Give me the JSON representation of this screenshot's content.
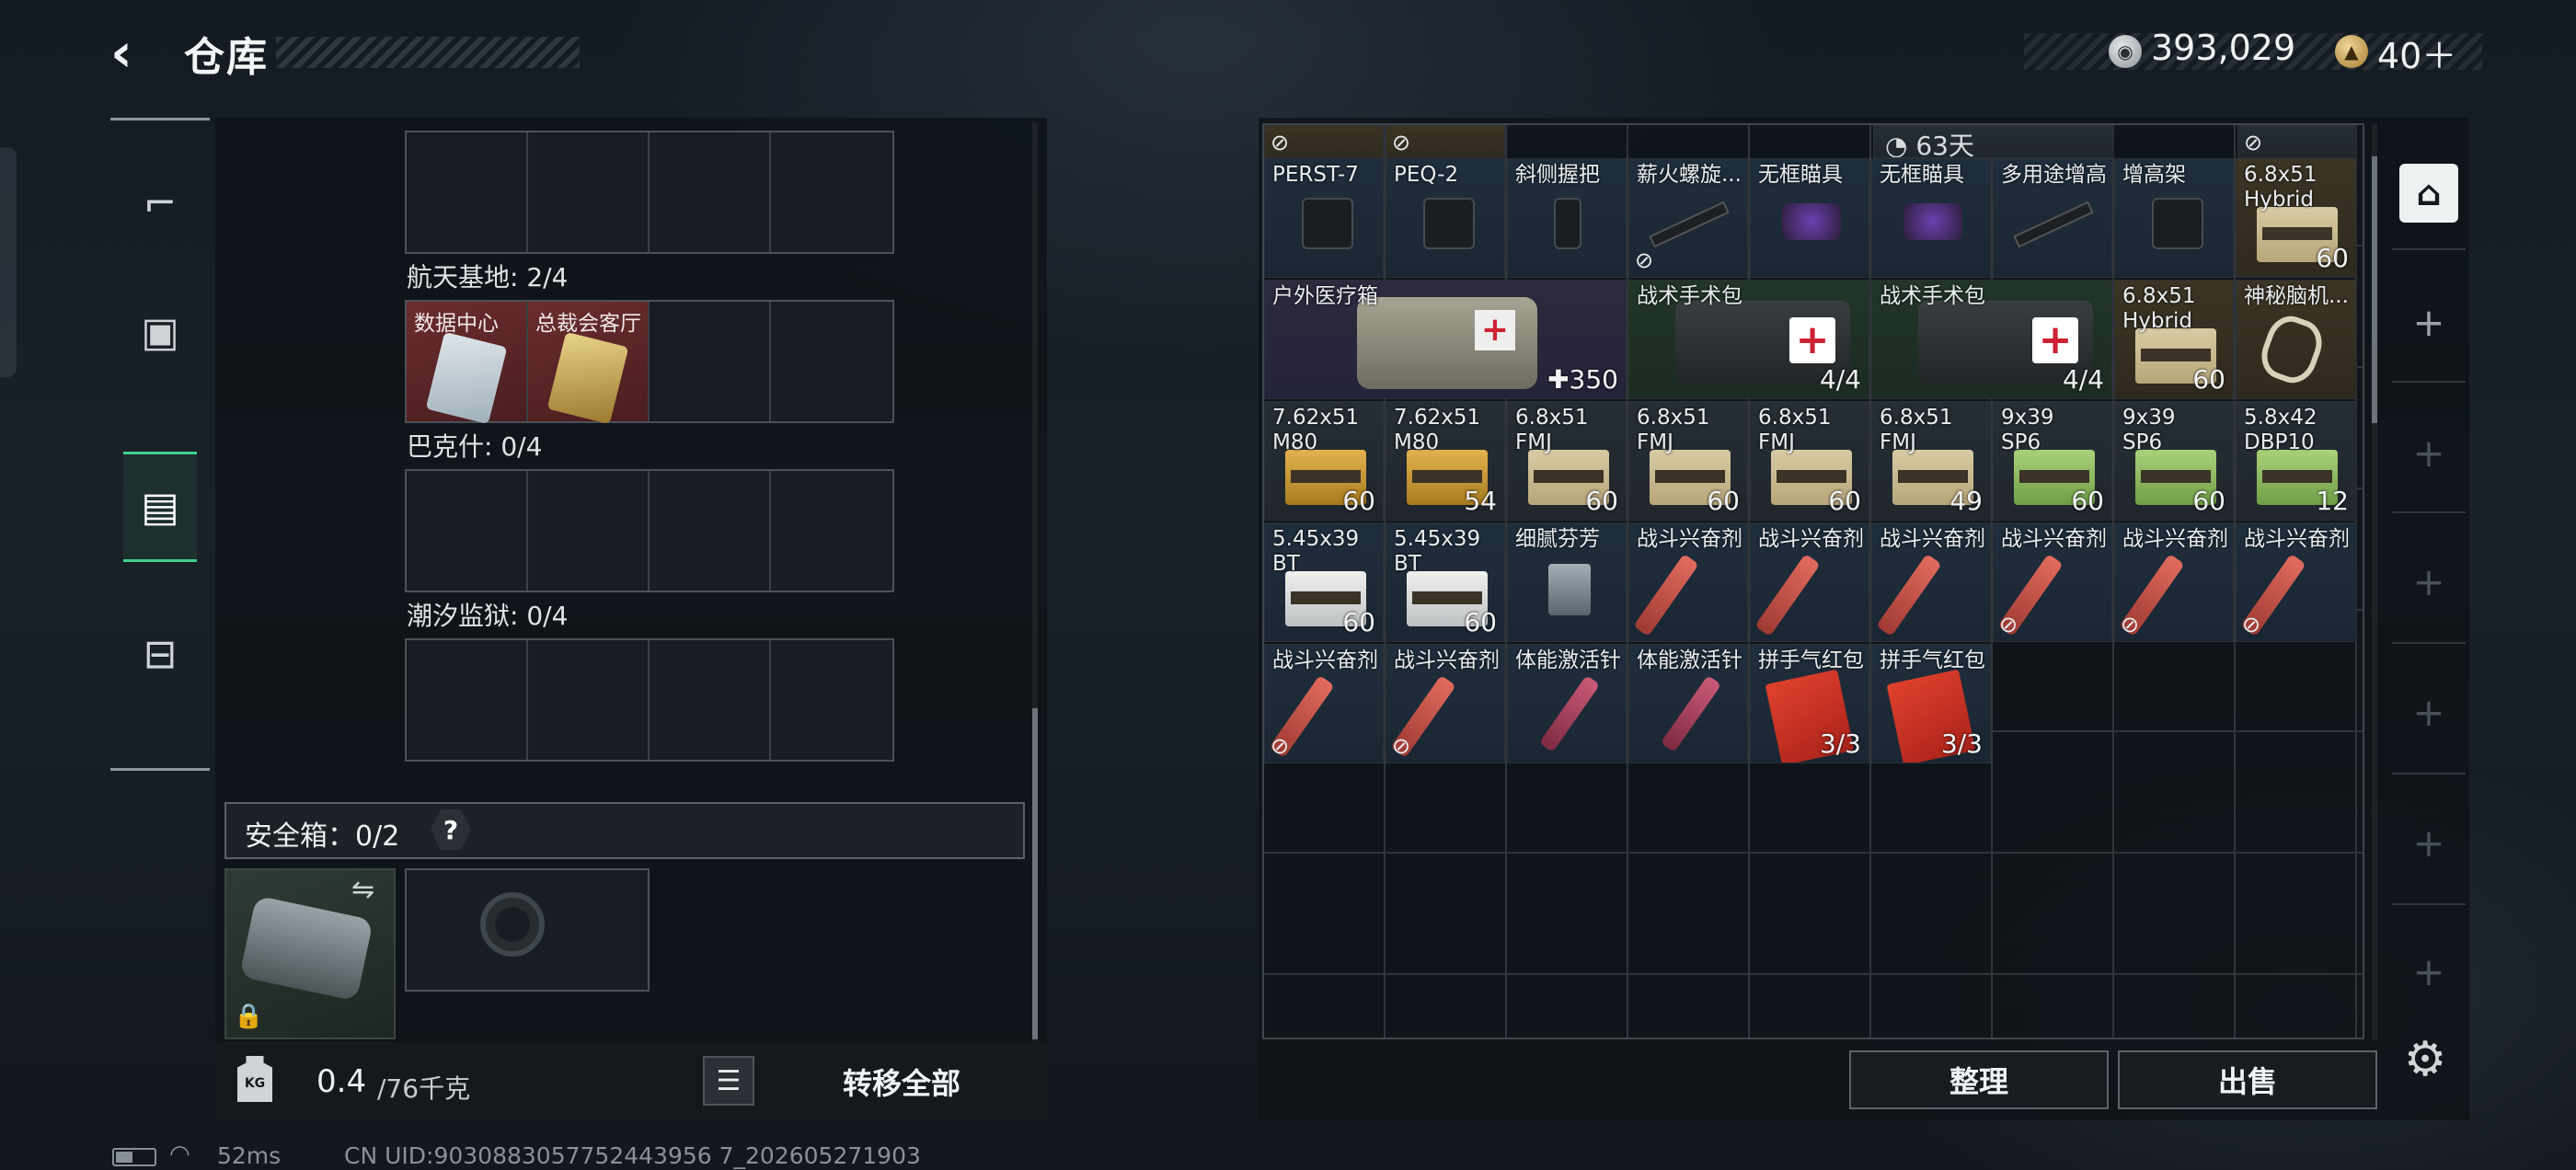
{
  "header": {
    "back": "‹",
    "title": "仓库",
    "money": "393,029",
    "tokens": "40＋"
  },
  "nav": {
    "items": [
      "weapon",
      "armor",
      "container",
      "toolbox"
    ]
  },
  "collections": [
    {
      "label": "",
      "cards": [
        "",
        "",
        "",
        ""
      ]
    },
    {
      "label": "航天基地: 2/4",
      "cards": [
        "数据中心",
        "总裁会客厅",
        "",
        ""
      ]
    },
    {
      "label": "巴克什: 0/4",
      "cards": [
        "",
        "",
        "",
        ""
      ]
    },
    {
      "label": "潮汐监狱: 0/4",
      "cards": [
        "",
        "",
        "",
        ""
      ]
    }
  ],
  "safe": {
    "label": "安全箱：0/2",
    "help": "?",
    "swap": "⇋",
    "lock": "🔒"
  },
  "footer": {
    "weight": "0.4",
    "weight_unit": "/76千克",
    "kg": "KG",
    "transfer": "转移全部"
  },
  "top_row": {
    "timer": "63天"
  },
  "items": [
    {
      "name": "PERST-7",
      "count": "",
      "lock": false
    },
    {
      "name": "PEQ-2",
      "count": "",
      "lock": false
    },
    {
      "name": "斜侧握把",
      "count": "",
      "lock": false
    },
    {
      "name": "薪火螺旋...",
      "count": "",
      "lock": true
    },
    {
      "name": "无框瞄具",
      "count": "",
      "lock": false
    },
    {
      "name": "无框瞄具",
      "count": "",
      "lock": false
    },
    {
      "name": "多用途增高",
      "count": "",
      "lock": false
    },
    {
      "name": "增高架",
      "count": "",
      "lock": false
    },
    {
      "name": "6.8x51\nHybrid",
      "count": "60",
      "lock": false
    },
    {
      "name": "户外医疗箱",
      "count": "✚350",
      "lock": false
    },
    {
      "name": "战术手术包",
      "count": "4/4",
      "lock": false
    },
    {
      "name": "战术手术包",
      "count": "4/4",
      "lock": false
    },
    {
      "name": "6.8x51\nHybrid",
      "count": "60",
      "lock": false
    },
    {
      "name": "神秘脑机...",
      "count": "",
      "lock": false
    },
    {
      "name": "7.62x51\nM80",
      "count": "60",
      "lock": false
    },
    {
      "name": "7.62x51\nM80",
      "count": "54",
      "lock": false
    },
    {
      "name": "6.8x51\nFMJ",
      "count": "60",
      "lock": false
    },
    {
      "name": "6.8x51\nFMJ",
      "count": "60",
      "lock": false
    },
    {
      "name": "6.8x51\nFMJ",
      "count": "60",
      "lock": false
    },
    {
      "name": "6.8x51\nFMJ",
      "count": "49",
      "lock": false
    },
    {
      "name": "9x39\nSP6",
      "count": "60",
      "lock": false
    },
    {
      "name": "9x39\nSP6",
      "count": "60",
      "lock": false
    },
    {
      "name": "5.8x42\nDBP10",
      "count": "12",
      "lock": false
    },
    {
      "name": "5.45x39\nBT",
      "count": "60",
      "lock": false
    },
    {
      "name": "5.45x39\nBT",
      "count": "60",
      "lock": false
    },
    {
      "name": "细腻芬芳",
      "count": "",
      "lock": false
    },
    {
      "name": "战斗兴奋剂",
      "count": "",
      "lock": false
    },
    {
      "name": "战斗兴奋剂",
      "count": "",
      "lock": false
    },
    {
      "name": "战斗兴奋剂",
      "count": "",
      "lock": false
    },
    {
      "name": "战斗兴奋剂",
      "count": "",
      "lock": true
    },
    {
      "name": "战斗兴奋剂",
      "count": "",
      "lock": true
    },
    {
      "name": "战斗兴奋剂",
      "count": "",
      "lock": true
    },
    {
      "name": "战斗兴奋剂",
      "count": "",
      "lock": true
    },
    {
      "name": "战斗兴奋剂",
      "count": "",
      "lock": true
    },
    {
      "name": "体能激活针",
      "count": "",
      "lock": false
    },
    {
      "name": "体能激活针",
      "count": "",
      "lock": false
    },
    {
      "name": "拼手气红包",
      "count": "3/3",
      "lock": false
    },
    {
      "name": "拼手气红包",
      "count": "3/3",
      "lock": false
    }
  ],
  "buttons": {
    "sort": "整理",
    "sell": "出售"
  },
  "status": {
    "ping": "52ms",
    "uid": "CN UID:9030883057752443956 7_202605271903"
  }
}
